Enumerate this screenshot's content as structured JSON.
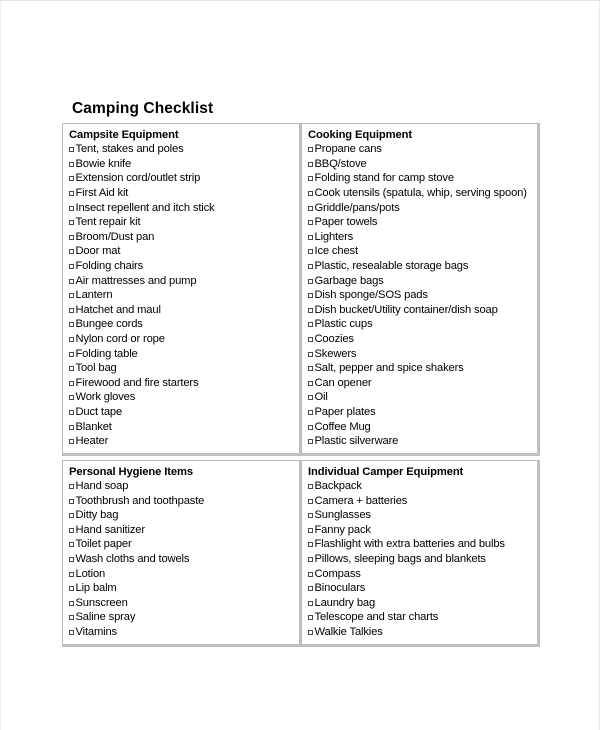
{
  "document": {
    "title": "Camping Checklist"
  },
  "checkbox_glyph": "empty-square",
  "colors": {
    "text": "#000000",
    "border": "#b9b9b9",
    "border_shadow": "#bfbfbf",
    "page_background": "#ffffff"
  },
  "sections": [
    {
      "id": "campsite-equipment",
      "title": "Campsite Equipment",
      "column": "left",
      "row": 1,
      "items": [
        "Tent, stakes and poles",
        "Bowie knife",
        "Extension cord/outlet strip",
        "First Aid kit",
        "Insect repellent and itch stick",
        "Tent repair kit",
        "Broom/Dust pan",
        "Door mat",
        "Folding chairs",
        "Air mattresses and pump",
        "Lantern",
        "Hatchet and maul",
        "Bungee cords",
        "Nylon cord or rope",
        "Folding table",
        "Tool bag",
        "Firewood and fire starters",
        "Work gloves",
        "Duct tape",
        "Blanket",
        "Heater"
      ]
    },
    {
      "id": "cooking-equipment",
      "title": "Cooking Equipment",
      "column": "right",
      "row": 1,
      "items": [
        "Propane cans",
        "BBQ/stove",
        "Folding stand for camp stove",
        "Cook utensils (spatula, whip, serving spoon)",
        "Griddle/pans/pots",
        "Paper towels",
        "Lighters",
        "Ice chest",
        "Plastic, resealable storage bags",
        "Garbage bags",
        "Dish sponge/SOS pads",
        "Dish bucket/Utility container/dish soap",
        "Plastic cups",
        "Coozies",
        "Skewers",
        "Salt, pepper and spice shakers",
        "Can opener",
        "Oil",
        "Paper plates",
        "Coffee Mug",
        "Plastic silverware"
      ]
    },
    {
      "id": "personal-hygiene-items",
      "title": "Personal Hygiene Items",
      "column": "left",
      "row": 2,
      "items": [
        "Hand soap",
        "Toothbrush and toothpaste",
        "Ditty bag",
        "Hand sanitizer",
        "Toilet paper",
        "Wash cloths and towels",
        "Lotion",
        "Lip balm",
        "Sunscreen",
        "Saline spray",
        "Vitamins"
      ]
    },
    {
      "id": "individual-camper-equipment",
      "title": "Individual Camper Equipment",
      "column": "right",
      "row": 2,
      "items": [
        "Backpack",
        "Camera + batteries",
        "Sunglasses",
        "Fanny pack",
        "Flashlight with extra batteries and bulbs",
        "Pillows, sleeping bags and blankets",
        "Compass",
        "Binoculars",
        "Laundry bag",
        "Telescope and star charts",
        "Walkie Talkies"
      ]
    }
  ]
}
